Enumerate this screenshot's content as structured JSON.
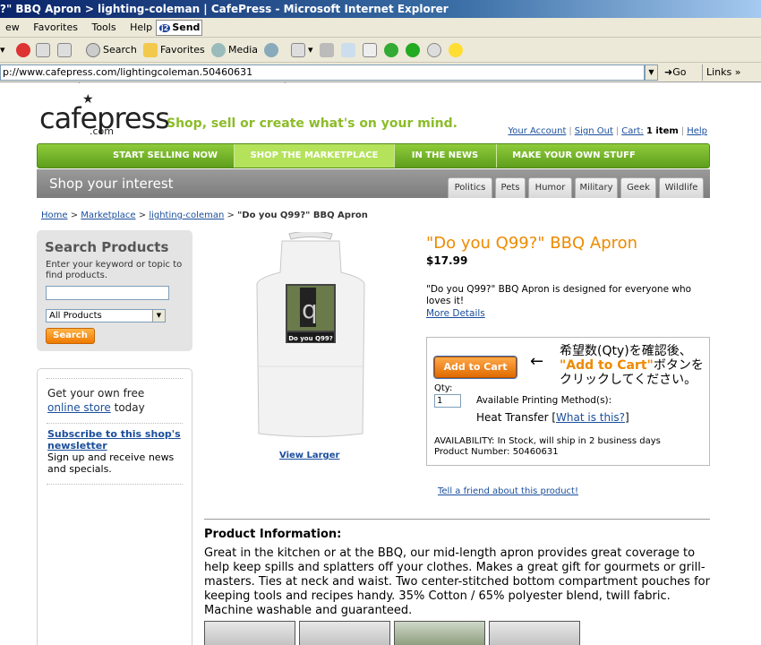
{
  "window": {
    "title": "?\" BBQ Apron > lighting-coleman | CafePress - Microsoft Internet Explorer"
  },
  "menubar": {
    "items": [
      "ew",
      "Favorites",
      "Tools",
      "Help"
    ],
    "j2send": "Send"
  },
  "toolbar": {
    "search": "Search",
    "favorites": "Favorites",
    "media": "Media"
  },
  "addressbar": {
    "url": "p://www.cafepress.com/lightingcoleman.50460631",
    "go": "Go",
    "links": "Links"
  },
  "site": {
    "logo": "cafepress",
    "logo_com": ".com",
    "tagline": "Shop, sell or create what's on your mind.",
    "account": {
      "your_account": "Your Account",
      "sign_out": "Sign Out",
      "cart": "Cart:",
      "cart_count": "1 item",
      "help": "Help"
    },
    "nav": [
      "START SELLING NOW",
      "SHOP THE MARKETPLACE",
      "IN THE NEWS",
      "MAKE YOUR OWN STUFF"
    ],
    "shop_interest": "Shop your interest",
    "categories": [
      "Politics",
      "Pets",
      "Humor",
      "Military",
      "Geek",
      "Wildlife"
    ]
  },
  "breadcrumb": {
    "home": "Home",
    "marketplace": "Marketplace",
    "shop": "lighting-coleman",
    "current": "\"Do you Q99?\" BBQ Apron"
  },
  "search": {
    "title": "Search Products",
    "help": "Enter your keyword or topic to find products.",
    "select_value": "All Products",
    "button": "Search"
  },
  "promo": {
    "line1": "Get your own free",
    "store_link": "online store",
    "line1_end": "today",
    "subscribe_link": "Subscribe to this shop's newsletter",
    "subscribe_text": "Sign up and receive news and specials."
  },
  "product": {
    "image_caption": "Do you Q99?",
    "view_larger": "View Larger",
    "title": "\"Do you Q99?\" BBQ Apron",
    "price": "$17.99",
    "description": "\"Do you Q99?\" BBQ Apron is designed for everyone who loves it!",
    "more_details": "More Details",
    "add_to_cart": "Add to Cart",
    "qty_label": "Qty:",
    "qty_value": "1",
    "printing_label": "Available Printing Method(s):",
    "printing_method": "Heat Transfer [",
    "what_is_this": "What is this?",
    "printing_close": "]",
    "availability": "AVAILABILITY: In Stock, will ship in 2 business days",
    "product_number": "Product Number: 50460631",
    "tell_friend": "Tell a friend about this product!",
    "info_heading": "Product Information:",
    "info_text": "Great in the kitchen or at the BBQ, our mid-length apron provides great coverage to help keep spills and splatters off your clothes. Makes a great gift for gourmets or grill-masters. Ties at neck and waist. Two center-stitched bottom compartment pouches for keeping tools and recipes handy. 35% Cotton / 65% polyester blend, twill fabric. Machine washable and guaranteed."
  },
  "annotation": {
    "arrow": "←",
    "line1": "希望数(Qty)を確認後、",
    "line2_highlight": "\"Add to Cart\"",
    "line2_rest": "ボタンを",
    "line3": "クリックしてください。"
  },
  "colors": {
    "brand_green": "#8cbc29",
    "title_orange": "#ee8a00",
    "link_blue": "#1a4e9c"
  }
}
